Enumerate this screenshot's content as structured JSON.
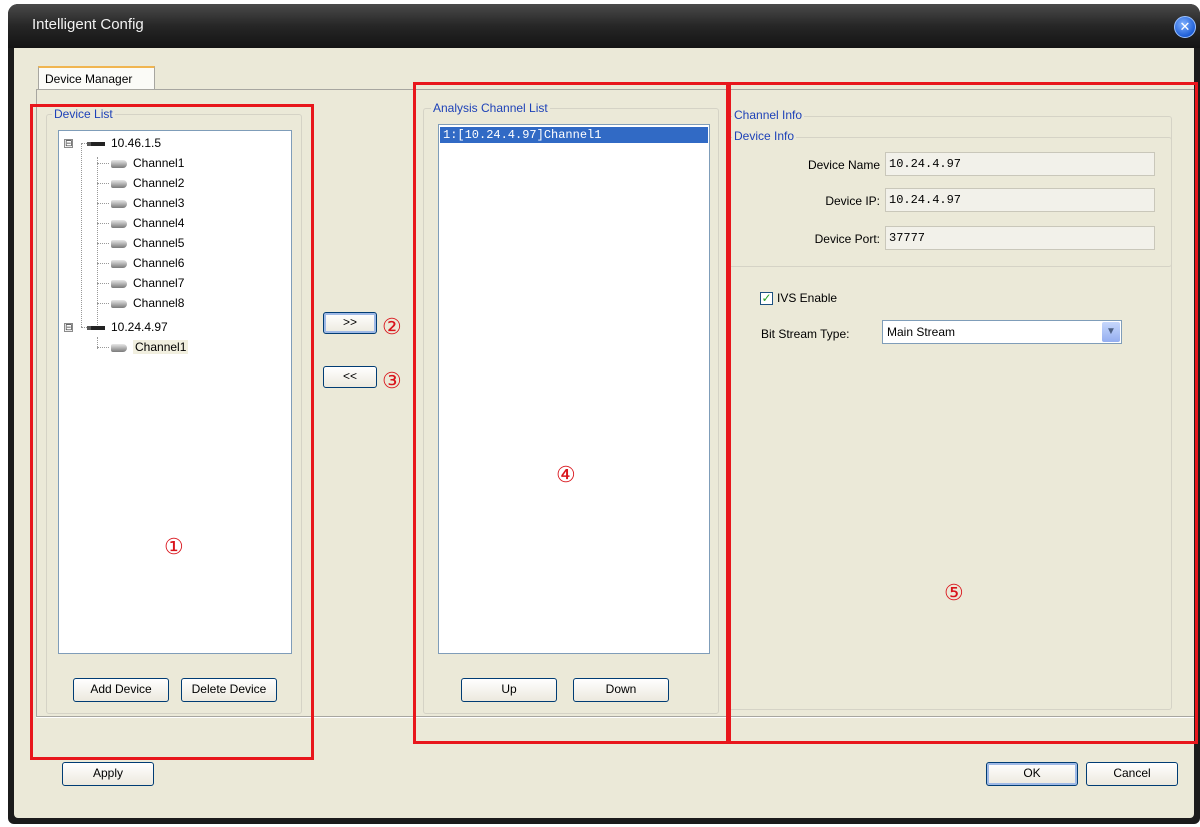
{
  "window": {
    "title": "Intelligent Config",
    "close_glyph": "✕"
  },
  "tab": {
    "label": "Device Manager"
  },
  "device_list": {
    "title": "Device List",
    "devices": [
      {
        "name": "10.46.1.5",
        "expander": "⊟",
        "channels": [
          "Channel1",
          "Channel2",
          "Channel3",
          "Channel4",
          "Channel5",
          "Channel6",
          "Channel7",
          "Channel8"
        ]
      },
      {
        "name": "10.24.4.97",
        "expander": "⊟",
        "channels": [
          "Channel1"
        ]
      }
    ],
    "add_label": "Add Device",
    "delete_label": "Delete Device"
  },
  "transfer": {
    "add_label": ">>",
    "remove_label": "<<"
  },
  "analysis": {
    "title": "Analysis Channel List",
    "items": [
      "1:[10.24.4.97]Channel1"
    ],
    "up_label": "Up",
    "down_label": "Down"
  },
  "channel_info": {
    "title": "Channel Info",
    "device_info_title": "Device Info",
    "name_label": "Device Name",
    "name_value": "10.24.4.97",
    "ip_label": "Device IP:",
    "ip_value": "10.24.4.97",
    "port_label": "Device Port:",
    "port_value": "37777",
    "ivs_label": "IVS Enable",
    "ivs_checked": true,
    "check_glyph": "✓",
    "stream_label": "Bit Stream Type:",
    "stream_value": "Main Stream",
    "dropdown_glyph": "▼"
  },
  "footer": {
    "apply_label": "Apply",
    "ok_label": "OK",
    "cancel_label": "Cancel"
  },
  "annotations": [
    "①",
    "②",
    "③",
    "④",
    "⑤"
  ],
  "colors": {
    "accent": "#316ac5",
    "annotation": "#e8161c",
    "group_title": "#1e42b8"
  }
}
